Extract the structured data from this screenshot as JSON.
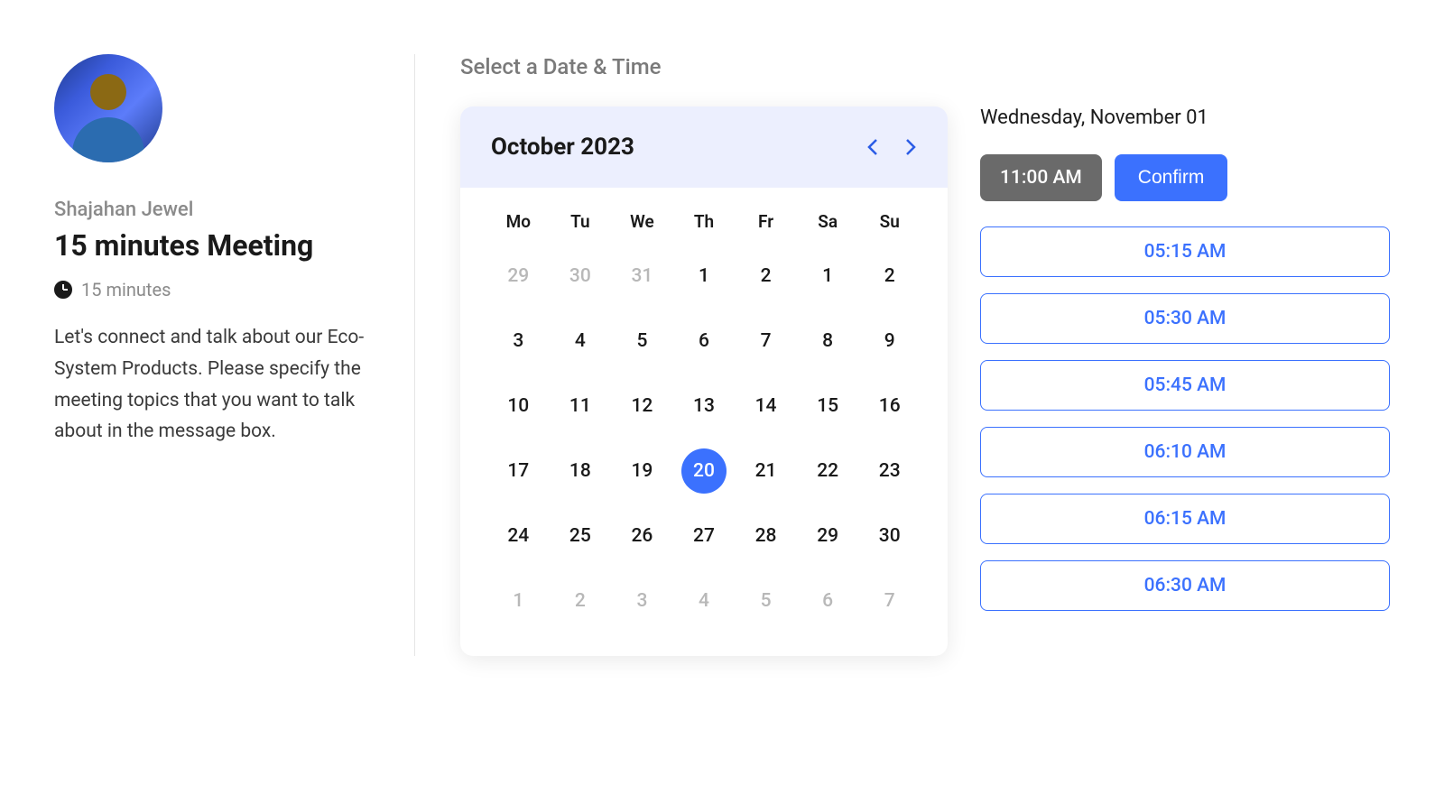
{
  "host": {
    "name": "Shajahan Jewel"
  },
  "meeting": {
    "title": "15 minutes Meeting",
    "duration": "15 minutes",
    "description": "Let's connect and talk about our Eco-System Products. Please specify the meeting topics that you want to talk about in the message box."
  },
  "section_title": "Select a Date & Time",
  "calendar": {
    "month_year": "October 2023",
    "weekdays": [
      "Mo",
      "Tu",
      "We",
      "Th",
      "Fr",
      "Sa",
      "Su"
    ],
    "days": [
      {
        "d": "29",
        "outside": true
      },
      {
        "d": "30",
        "outside": true
      },
      {
        "d": "31",
        "outside": true
      },
      {
        "d": "1"
      },
      {
        "d": "2"
      },
      {
        "d": "1"
      },
      {
        "d": "2"
      },
      {
        "d": "3"
      },
      {
        "d": "4"
      },
      {
        "d": "5"
      },
      {
        "d": "6"
      },
      {
        "d": "7"
      },
      {
        "d": "8"
      },
      {
        "d": "9"
      },
      {
        "d": "10"
      },
      {
        "d": "11"
      },
      {
        "d": "12"
      },
      {
        "d": "13"
      },
      {
        "d": "14"
      },
      {
        "d": "15"
      },
      {
        "d": "16"
      },
      {
        "d": "17"
      },
      {
        "d": "18"
      },
      {
        "d": "19"
      },
      {
        "d": "20",
        "selected": true
      },
      {
        "d": "21"
      },
      {
        "d": "22"
      },
      {
        "d": "23"
      },
      {
        "d": "24"
      },
      {
        "d": "25"
      },
      {
        "d": "26"
      },
      {
        "d": "27"
      },
      {
        "d": "28"
      },
      {
        "d": "29"
      },
      {
        "d": "30"
      },
      {
        "d": "1",
        "outside": true
      },
      {
        "d": "2",
        "outside": true
      },
      {
        "d": "3",
        "outside": true
      },
      {
        "d": "4",
        "outside": true
      },
      {
        "d": "5",
        "outside": true
      },
      {
        "d": "6",
        "outside": true
      },
      {
        "d": "7",
        "outside": true
      }
    ]
  },
  "time_picker": {
    "selected_date_label": "Wednesday, November 01",
    "selected_time": "11:00 AM",
    "confirm_label": "Confirm",
    "slots": [
      "05:15 AM",
      "05:30 AM",
      "05:45 AM",
      "06:10 AM",
      "06:15 AM",
      "06:30 AM"
    ]
  }
}
